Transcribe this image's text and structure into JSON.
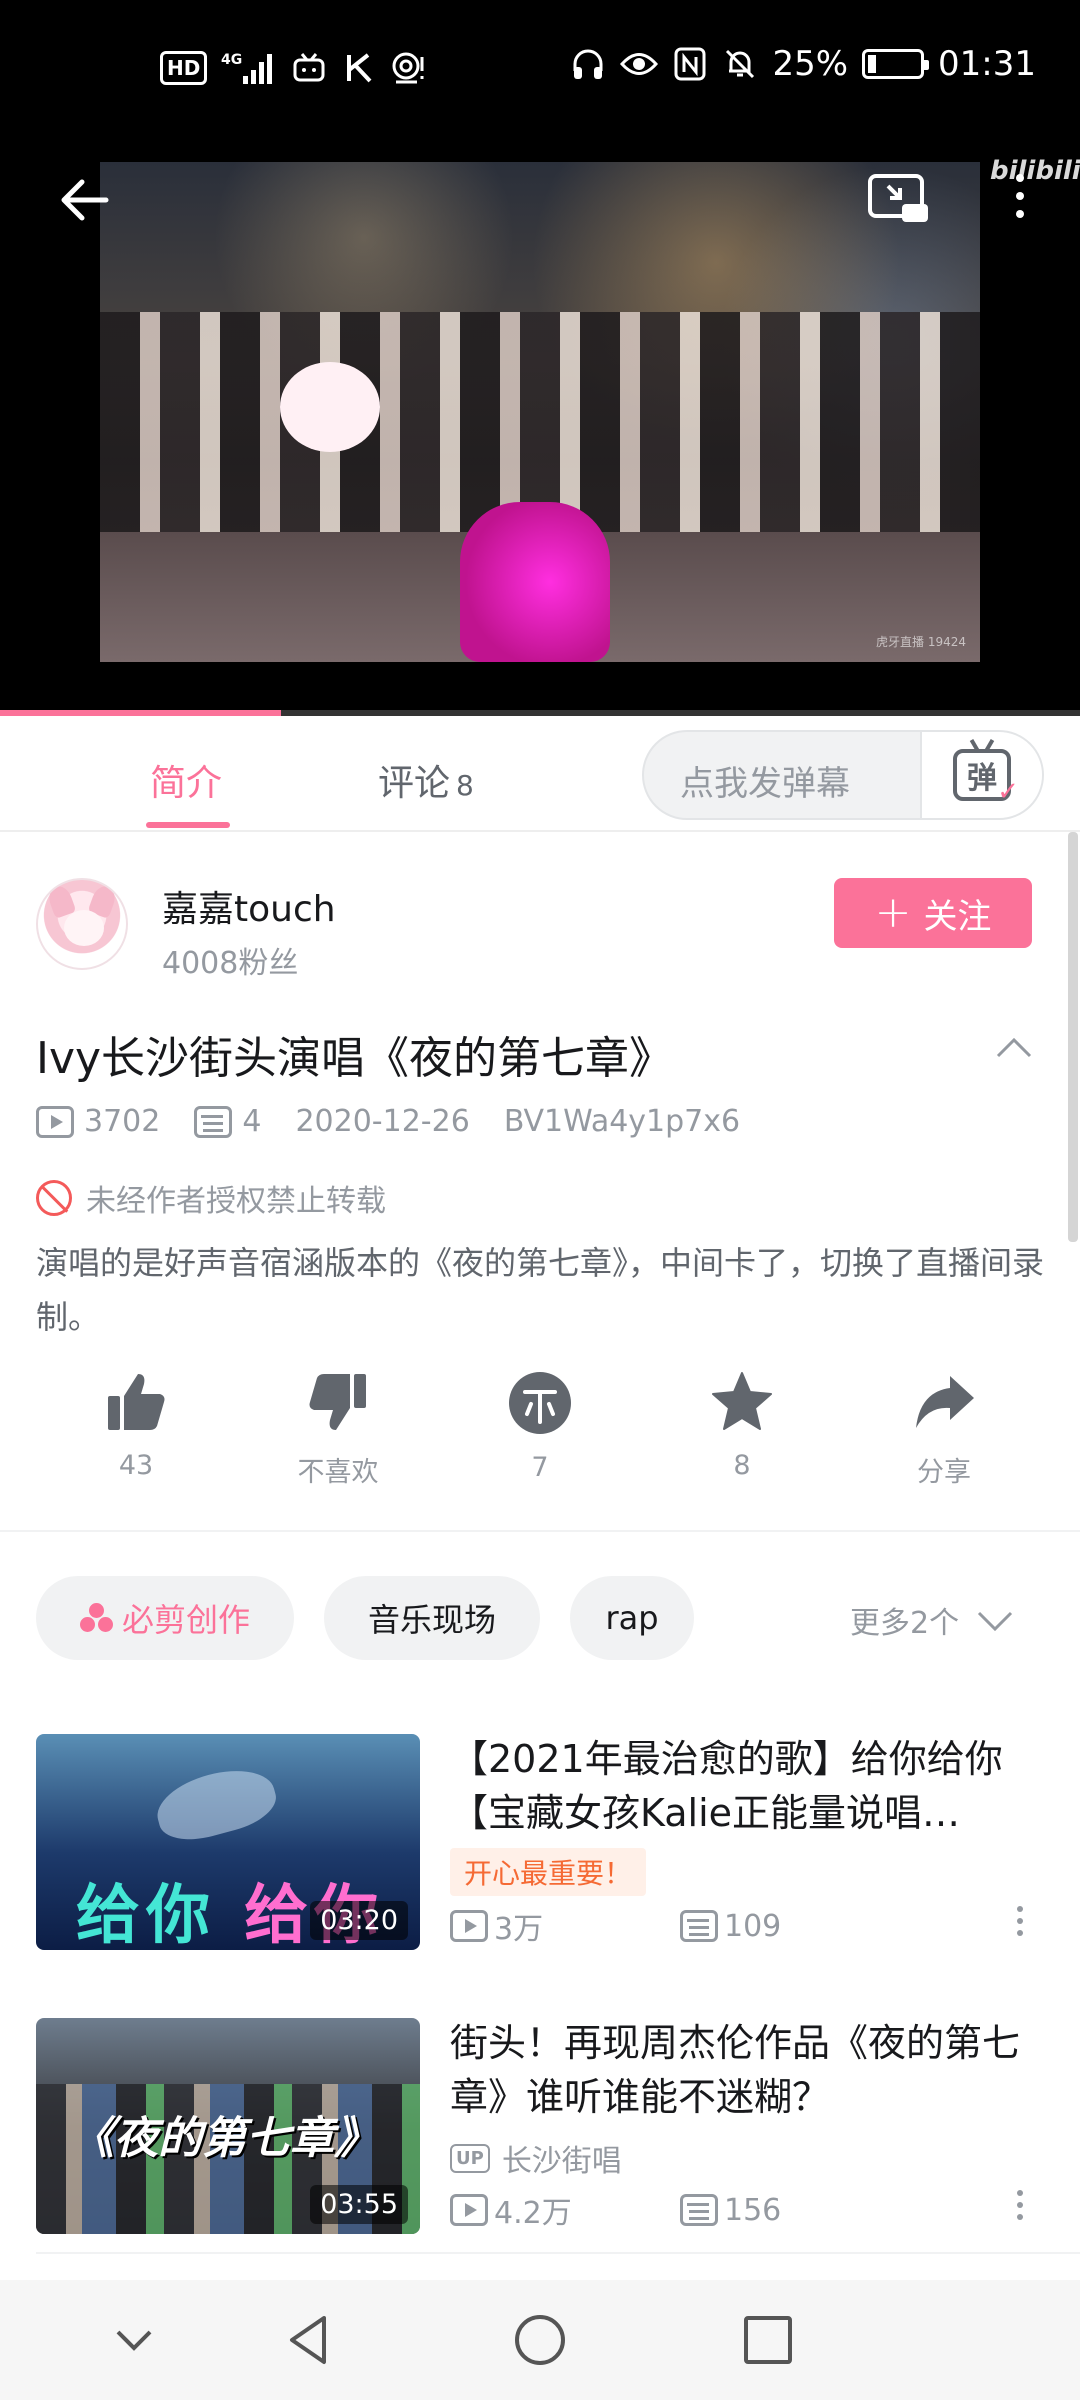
{
  "status_bar": {
    "left_icons": [
      "hd-icon",
      "signal-4g-icon",
      "tv-icon",
      "k-icon",
      "nfc-tag-icon"
    ],
    "hd_label": "HD",
    "network_label": "4G",
    "right_icons": [
      "headphones-icon",
      "eye-icon",
      "nfc-icon",
      "mute-icon"
    ],
    "battery": "25%",
    "battery_level": 0.25,
    "time": "01:31"
  },
  "player": {
    "logo": "bilibili",
    "watermark": "虎牙直播 19424",
    "progress": 0.26
  },
  "tabs": {
    "intro": "简介",
    "comments": "评论",
    "comments_count": "8",
    "danmaku_placeholder": "点我发弹幕",
    "danmaku_button": "弹"
  },
  "uploader": {
    "name": "嘉嘉touch",
    "fans": "4008粉丝",
    "follow_label": "关注"
  },
  "video": {
    "title": "Ivy长沙街头演唱《夜的第七章》",
    "plays": "3702",
    "danmaku": "4",
    "date": "2020-12-26",
    "bvid": "BV1Wa4y1p7x6",
    "notice": "未经作者授权禁止转载",
    "description": "演唱的是好声音宿涵版本的《夜的第七章》，中间卡了，切换了直播间录制。"
  },
  "actions": [
    {
      "icon": "like-icon",
      "label": "43"
    },
    {
      "icon": "dislike-icon",
      "label": "不喜欢"
    },
    {
      "icon": "coin-icon",
      "label": "7"
    },
    {
      "icon": "star-icon",
      "label": "8"
    },
    {
      "icon": "share-icon",
      "label": "分享"
    }
  ],
  "tags": {
    "special": "必剪创作",
    "music": "音乐现场",
    "rap": "rap",
    "more": "更多2个"
  },
  "related": [
    {
      "title": "【2021年最治愈的歌】给你给你【宝藏女孩Kalie正能量说唱…",
      "badge": "开心最重要！",
      "plays": "3万",
      "danmaku": "109",
      "duration": "03:20",
      "thumb_text_a": "给你",
      "thumb_text_b": "给你"
    },
    {
      "title": "街头！再现周杰伦作品《夜的第七章》谁听谁能不迷糊？",
      "uploader": "长沙街唱",
      "up_badge": "UP",
      "plays": "4.2万",
      "danmaku": "156",
      "duration": "03:55",
      "thumb_text": "《夜的第七章》"
    }
  ],
  "colors": {
    "accent": "#fb7299",
    "text_primary": "#18191c",
    "text_secondary": "#9499a0",
    "badge_orange": "#f56a34"
  }
}
